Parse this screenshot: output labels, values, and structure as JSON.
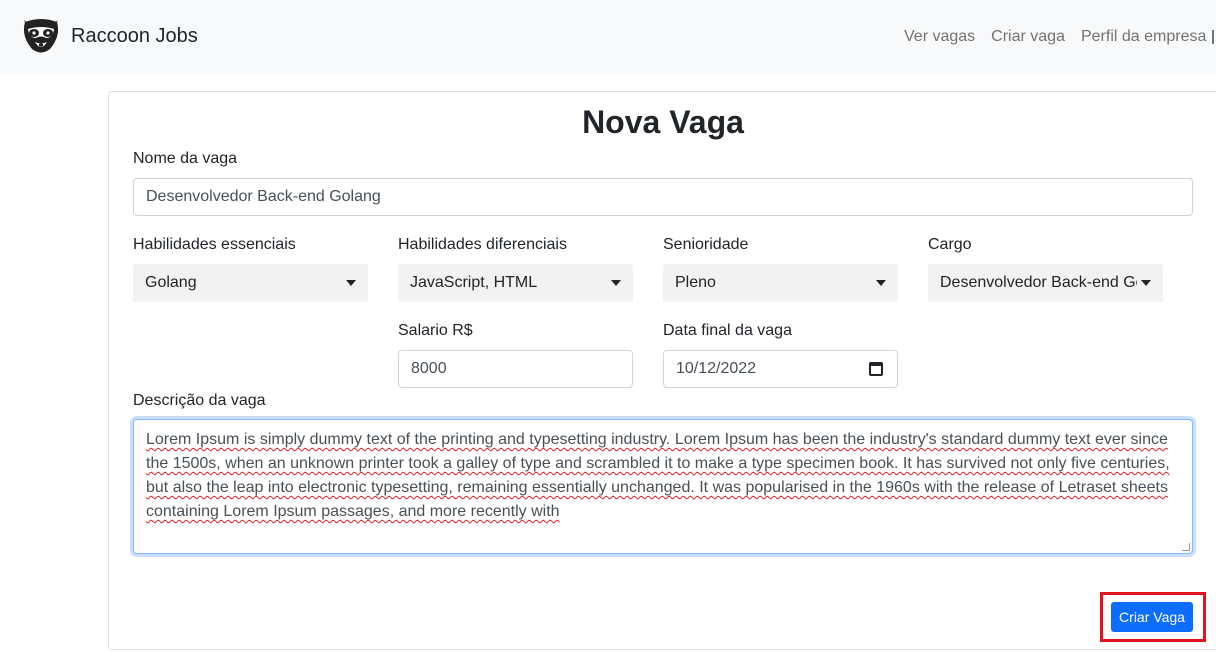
{
  "navbar": {
    "brand": "Raccoon Jobs",
    "links": [
      "Ver vagas",
      "Criar vaga",
      "Perfil da empresa"
    ]
  },
  "form": {
    "title": "Nova Vaga",
    "job_name": {
      "label": "Nome da vaga",
      "value": "Desenvolvedor Back-end Golang"
    },
    "essential_skills": {
      "label": "Habilidades essenciais",
      "value": "Golang"
    },
    "differential_skills": {
      "label": "Habilidades diferenciais",
      "value": "JavaScript, HTML"
    },
    "seniority": {
      "label": "Senioridade",
      "value": "Pleno"
    },
    "role": {
      "label": "Cargo",
      "value": "Desenvolvedor Back-end Golang"
    },
    "salary": {
      "label": "Salario R$",
      "value": "8000"
    },
    "end_date": {
      "label": "Data final da vaga",
      "value": "10/12/2022"
    },
    "description": {
      "label": "Descrição da vaga",
      "value": "Lorem Ipsum is simply dummy text of the printing and typesetting industry. Lorem Ipsum has been the industry's standard dummy text ever since the 1500s, when an unknown printer took a galley of type and scrambled it to make a type specimen book. It has survived not only five centuries, but also the leap into electronic typesetting, remaining essentially unchanged. It was popularised in the 1960s with the release of Letraset sheets containing Lorem Ipsum passages, and more recently with"
    },
    "submit_label": "Criar Vaga"
  },
  "colors": {
    "navbar_bg": "#f8f9fa",
    "primary": "#0d6efd",
    "highlight": "#e0141e"
  },
  "icons": {
    "logo": "raccoon-logo",
    "dropdown": "caret-down-icon",
    "date": "calendar-icon"
  }
}
